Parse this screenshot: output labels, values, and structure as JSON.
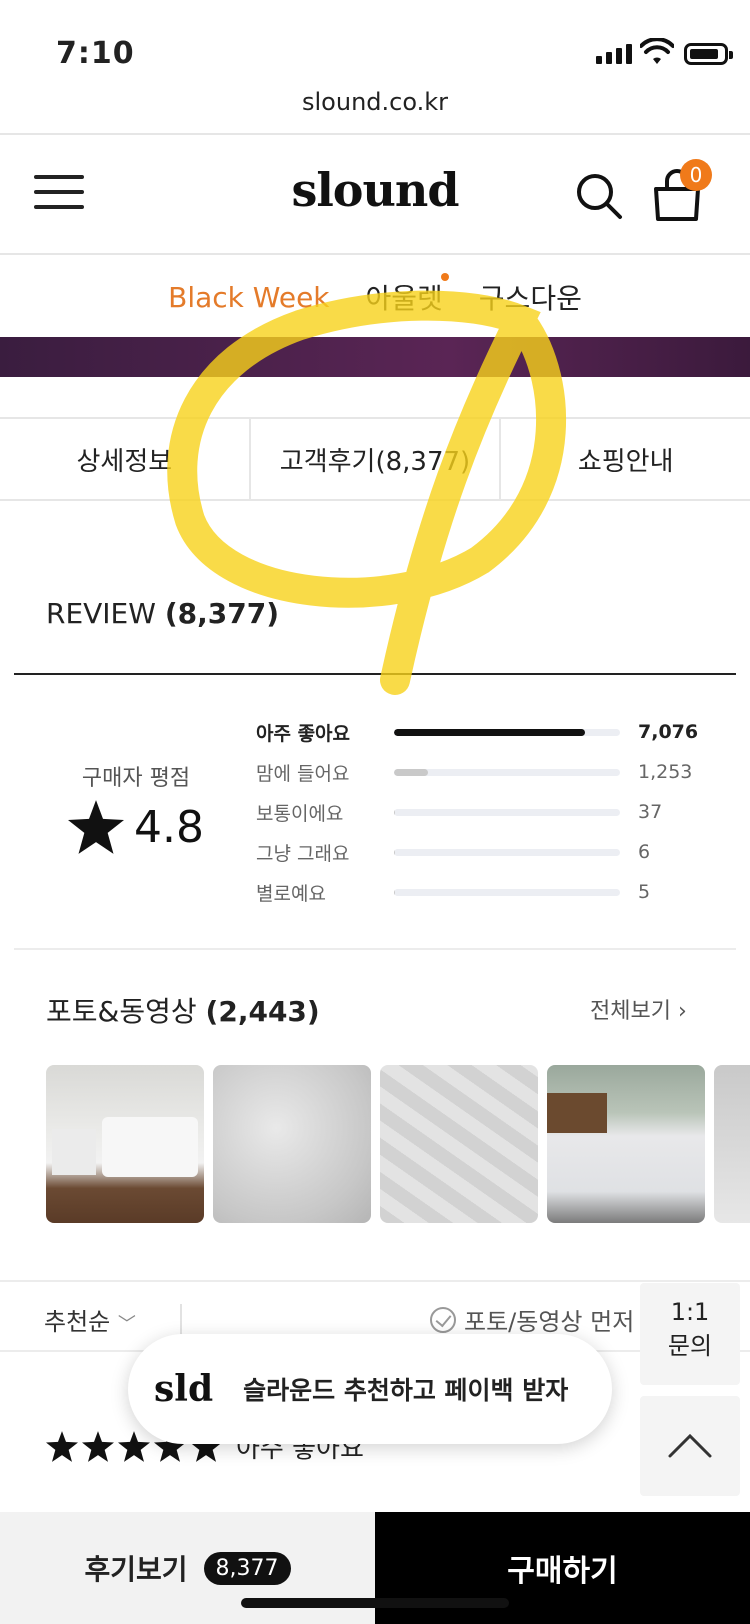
{
  "status": {
    "time": "7:10"
  },
  "browser": {
    "url": "slound.co.kr"
  },
  "header": {
    "logo": "slound",
    "cart_count": "0"
  },
  "gnb": {
    "items": [
      "Black Week",
      "아울렛",
      "구스다운"
    ]
  },
  "tabs": [
    "상세정보",
    "고객후기(8,377)",
    "쇼핑안내"
  ],
  "review": {
    "title": "REVIEW",
    "count": "(8,377)",
    "rating_label": "구매자 평점",
    "rating_value": "4.8",
    "breakdown": [
      {
        "label": "아주 좋아요",
        "count": "7,076",
        "ratio": 0.8447
      },
      {
        "label": "맘에 들어요",
        "count": "1,253",
        "ratio": 0.1496
      },
      {
        "label": "보통이에요",
        "count": "37",
        "ratio": 0.0044
      },
      {
        "label": "그냥 그래요",
        "count": "6",
        "ratio": 0.0007
      },
      {
        "label": "별로예요",
        "count": "5",
        "ratio": 0.0006
      }
    ]
  },
  "photos": {
    "title": "포토&동영상",
    "count": "(2,443)",
    "view_all": "전체보기"
  },
  "sort": {
    "label": "추천순",
    "photo_first": "포토/동영상 먼저 보기"
  },
  "first_review": {
    "rating_text": "아주 좋아요"
  },
  "floating": {
    "inquiry": "1:1",
    "inquiry_sub": "문의"
  },
  "popup": {
    "logo": "sld",
    "text": "슬라운드 추천하고 페이백 받자"
  },
  "bottom": {
    "review_label": "후기보기",
    "review_count": "8,377",
    "buy_label": "구매하기"
  },
  "colors": {
    "accent": "#e47b2a",
    "badge": "#f07a1a",
    "highlight": "#f7d21a"
  }
}
